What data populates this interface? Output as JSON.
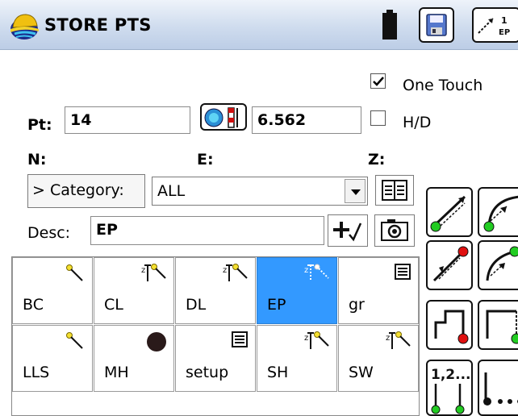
{
  "title": "STORE PTS",
  "toolbar": {
    "battery_icon": "battery-icon",
    "save_icon": "save-disk-icon",
    "ep_icon": "store-ep-icon",
    "ep_text": "1 EP"
  },
  "options": {
    "one_touch_label": "One Touch",
    "one_touch_checked": true,
    "hd_label": "H/D",
    "hd_checked": false
  },
  "point": {
    "pt_label": "Pt:",
    "pt_value": "14",
    "height_value": "6.562"
  },
  "coords": {
    "n_label": "N:",
    "e_label": "E:",
    "z_label": "Z:"
  },
  "category": {
    "button_label": "> Category:",
    "selected": "ALL"
  },
  "desc": {
    "label": "Desc:",
    "value": "EP"
  },
  "codes": [
    {
      "label": "BC",
      "icon": "point-icon",
      "selected": false
    },
    {
      "label": "CL",
      "icon": "rod-point-icon",
      "selected": false
    },
    {
      "label": "DL",
      "icon": "rod-point-icon",
      "selected": false
    },
    {
      "label": "EP",
      "icon": "rod-point-icon",
      "selected": true
    },
    {
      "label": "gr",
      "icon": "note-icon",
      "selected": false
    },
    {
      "label": "LLS",
      "icon": "point-icon",
      "selected": false
    },
    {
      "label": "MH",
      "icon": "manhole-icon",
      "selected": false
    },
    {
      "label": "setup",
      "icon": "note-icon",
      "selected": false
    },
    {
      "label": "SH",
      "icon": "rod-point-icon",
      "selected": false
    },
    {
      "label": "SW",
      "icon": "rod-point-icon",
      "selected": false
    }
  ],
  "side_numbers": {
    "seq_text": "1,2..."
  },
  "colors": {
    "selected": "#3399ff",
    "green": "#22cc22",
    "red": "#e01010"
  }
}
